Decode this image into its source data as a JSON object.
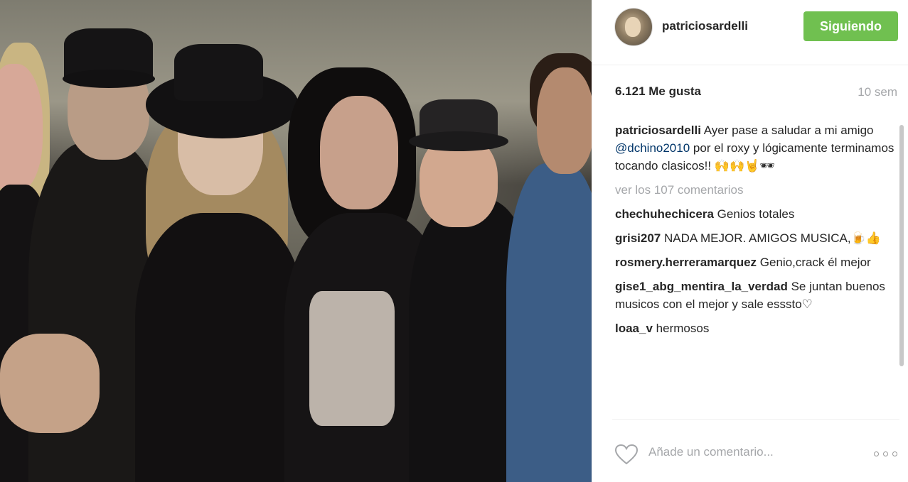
{
  "post": {
    "username": "patriciosardelli",
    "follow_label": "Siguiendo",
    "likes": "6.121 Me gusta",
    "time": "10 sem",
    "caption_user": "patriciosardelli",
    "caption_text_1": "Ayer pase a saludar a mi amigo",
    "caption_mention": "@dchino2010",
    "caption_text_2": "por el roxy y lógicamente terminamos tocando clasicos!! 🙌🙌🤘🕶",
    "view_all": "ver los 107 comentarios",
    "comments": [
      {
        "user": "chechuhechicera",
        "text": "Genios totales"
      },
      {
        "user": "grisi207",
        "text": "NADA MEJOR. AMIGOS MUSICA,🍺👍"
      },
      {
        "user": "rosmery.herreramarquez",
        "text": "Genio,crack él mejor"
      },
      {
        "user": "gise1_abg_mentira_la_verdad",
        "text": "Se juntan buenos musicos con el mejor y sale esssto♡"
      },
      {
        "user": "loaa_v",
        "text": "hermosos"
      }
    ],
    "add_comment_placeholder": "Añade un comentario...",
    "icons": {
      "like": "heart-outline-icon",
      "more": "more-options-icon"
    },
    "colors": {
      "follow_button": "#70c050",
      "mention": "#003569",
      "muted": "#a5a7aa"
    }
  }
}
